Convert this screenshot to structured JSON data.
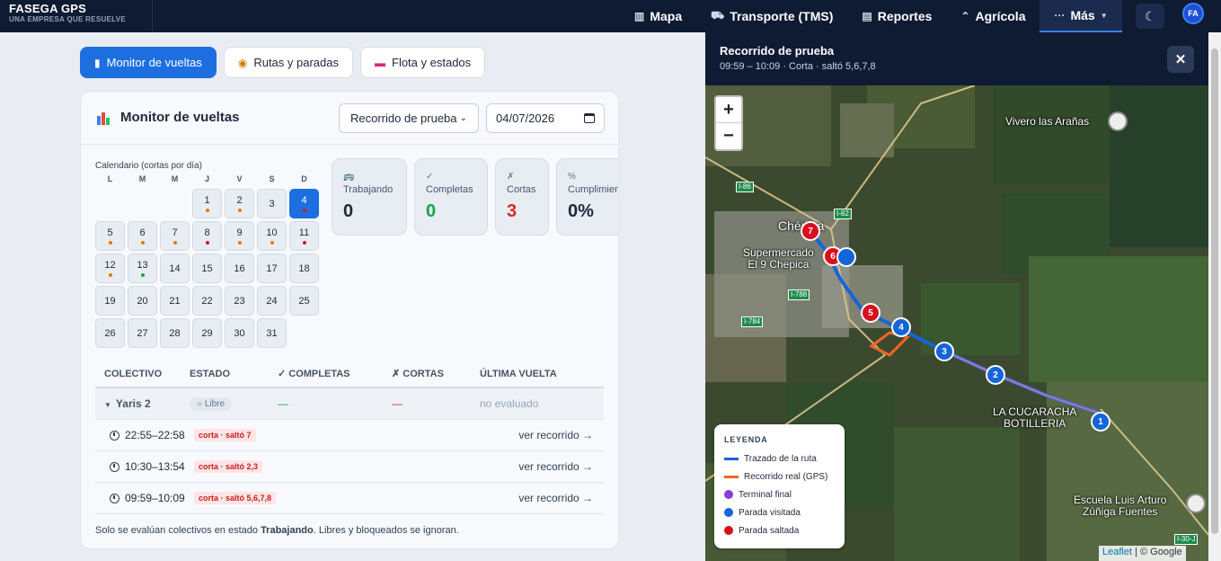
{
  "brand": {
    "name": "FASEGA GPS",
    "tagline": "UNA EMPRESA QUE RESUELVE"
  },
  "nav": {
    "items": [
      {
        "icon": "map-icon",
        "label": "Mapa"
      },
      {
        "icon": "truck-icon",
        "label": "Transporte (TMS)"
      },
      {
        "icon": "report-icon",
        "label": "Reportes"
      },
      {
        "icon": "agriculture-icon",
        "label": "Agrícola"
      },
      {
        "icon": "more-icon",
        "label": "Más"
      }
    ],
    "avatar": "FA"
  },
  "tabs": [
    {
      "label": "Monitor de vueltas",
      "active": true
    },
    {
      "label": "Rutas y paradas",
      "active": false
    },
    {
      "label": "Flota y estados",
      "active": false
    }
  ],
  "monitor": {
    "title": "Monitor de vueltas",
    "route_select": "Recorrido de prueba",
    "date": "04/07/2026",
    "calendar_label": "Calendario (cortas por día)",
    "weekdays": [
      "L",
      "M",
      "M",
      "J",
      "V",
      "S",
      "D"
    ],
    "stats": [
      {
        "label": "Trabajando",
        "value": "0",
        "color": "#1e293b",
        "icon": "bus-icon"
      },
      {
        "label": "Completas",
        "value": "0",
        "color": "#16a34a",
        "icon": "check-icon"
      },
      {
        "label": "Cortas",
        "value": "3",
        "color": "#dc2626",
        "icon": "cross-icon"
      },
      {
        "label": "Cumplimiento",
        "value": "0%",
        "color": "#1e293b",
        "icon": "percent-icon"
      }
    ],
    "table": {
      "headers": [
        "COLECTIVO",
        "ESTADO",
        "✓ COMPLETAS",
        "✗ CORTAS",
        "ÚLTIMA VUELTA"
      ],
      "group": {
        "name": "Yaris 2",
        "status": "Libre",
        "completas": "—",
        "cortas": "—",
        "ultima": "no evaluado"
      },
      "trips": [
        {
          "time": "22:55–22:58",
          "badge": "corta · saltó 7",
          "link": "ver recorrido →"
        },
        {
          "time": "10:30–13:54",
          "badge": "corta · saltó 2,3",
          "link": "ver recorrido →"
        },
        {
          "time": "09:59–10:09",
          "badge": "corta · saltó 5,6,7,8",
          "link": "ver recorrido →"
        }
      ]
    },
    "footnote_pre": "Solo se evalúan colectivos en estado ",
    "footnote_bold": "Trabajando",
    "footnote_post": ". Libres y bloqueados se ignoran."
  },
  "panel": {
    "title": "Recorrido de prueba",
    "subtitle": "09:59 – 10:09 · Corta · saltó 5,6,7,8",
    "map_labels": {
      "town": "Chépica",
      "super": "Supermercado\nEl 9 Chepica",
      "vivero": "Vivero las Arañas",
      "cucaracha": "LA CUCARACHA\nBOTILLERIA",
      "escuela": "Escuela Luis Arturo\nZúñiga Fuentes"
    },
    "road_tags": [
      "I-86",
      "I-82",
      "I-788",
      "I-784",
      "I-30-J"
    ],
    "legend": {
      "title": "LEYENDA",
      "items": [
        {
          "label": "Trazado de la ruta",
          "color": "#1565d8"
        },
        {
          "label": "Recorrido real (GPS)",
          "color": "#f26522"
        },
        {
          "label": "Terminal final",
          "color": "#8b3bd9"
        },
        {
          "label": "Parada visitada",
          "color": "#1565d8"
        },
        {
          "label": "Parada saltada",
          "color": "#d90f1c"
        }
      ]
    },
    "attribution": {
      "leaflet": "Leaflet",
      "rest": " | © Google"
    }
  }
}
